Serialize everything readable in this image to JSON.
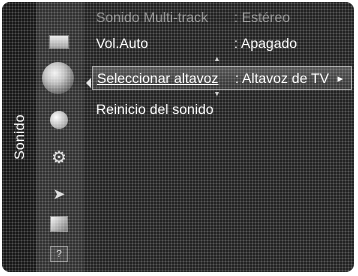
{
  "sidebar": {
    "title": "Sonido",
    "icons": [
      "picture-icon",
      "sound-icon",
      "channel-icon",
      "setup-icon",
      "input-icon",
      "application-icon",
      "support-icon"
    ]
  },
  "menu": {
    "items": [
      {
        "label": "Sonido Multi-track",
        "value": ": Estéreo",
        "state": "dim"
      },
      {
        "label": "Vol.Auto",
        "value": ": Apagado",
        "state": "normal"
      },
      {
        "label": "Seleccionar altavoz",
        "value": ": Altavoz de TV",
        "state": "highlight",
        "chevron": "▸"
      },
      {
        "label": "Reinicio del sonido",
        "value": "",
        "state": "normal"
      }
    ],
    "scroll_up": "▲",
    "scroll_down": "▼"
  },
  "colors": {
    "background": "#1a1a1a",
    "highlight": "#4e4e4e",
    "dim_text": "#8c8c8c",
    "text": "#ffffff"
  }
}
